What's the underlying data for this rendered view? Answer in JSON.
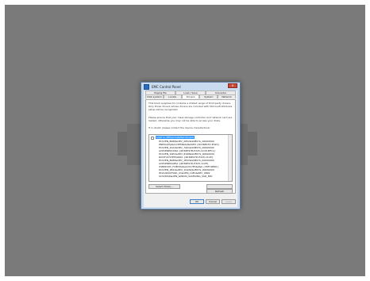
{
  "window": {
    "title": "EMC Control Panel",
    "close_label": "x"
  },
  "tabs_back": [
    "Paging file",
    "Load / Save",
    "AirLoader"
  ],
  "tabs_front": [
    "Disk system",
    "Locate",
    "Drivers",
    "System",
    "Network"
  ],
  "drivers_page": {
    "paragraph1": "This block supplies I/O contains a limited range of third-party drivers. Only those drivers whose drivers are included with Microsoft Windows setup will be recognized.",
    "paragraph2": "Please ensure that your mass storage controller and network card are loaded, otherwise you may not be able to access your disks.",
    "paragraph3": "If in doubt, please contact the device manufacturer.",
    "root_item": "Load in official installed drivers",
    "children": [
      "PCI\\VEN_8086&DEV_2652&SUBSYS_00000000",
      "PNP0A03\\4&1A3E5B2&0&00E0 {4D36E97D-E325}",
      "PCI\\VEN_1022&DEV_7901&SUBSYS_00000000",
      "ACPI\\PNP0C09\\0 {4D36E97B-E325-11CE-BFC1}",
      "PCI\\VEN_10EC&DEV_8168&SUBSYS_00000000",
      "ROOT\\SYSTEM\\0000 {4D36E97D-E325-11CE}",
      "PCI\\VEN_8086&DEV_1E03&SUBSYS_00000000",
      "ACPI\\PNP0A08\\0 {4D36E97D-E325-11CE}",
      "USB\\ROOT_HUB30\\4&2A3C7E5&0&0 {36FC9E60}",
      "PCI\\VEN_1B21&DEV_1042&SUBSYS_00000000",
      "HDAUDIO\\FUNC_01&VEN_10EC&DEV_0892",
      "SCSI\\DISK&VEN_&PROD_SAMSUNG_SSD_850"
    ],
    "select_folder_label": "Select folder...",
    "refresh_label": "Refresh"
  },
  "footer": {
    "ok_label": "OK",
    "cancel_label": "Cancel",
    "apply_label": "Apply"
  }
}
